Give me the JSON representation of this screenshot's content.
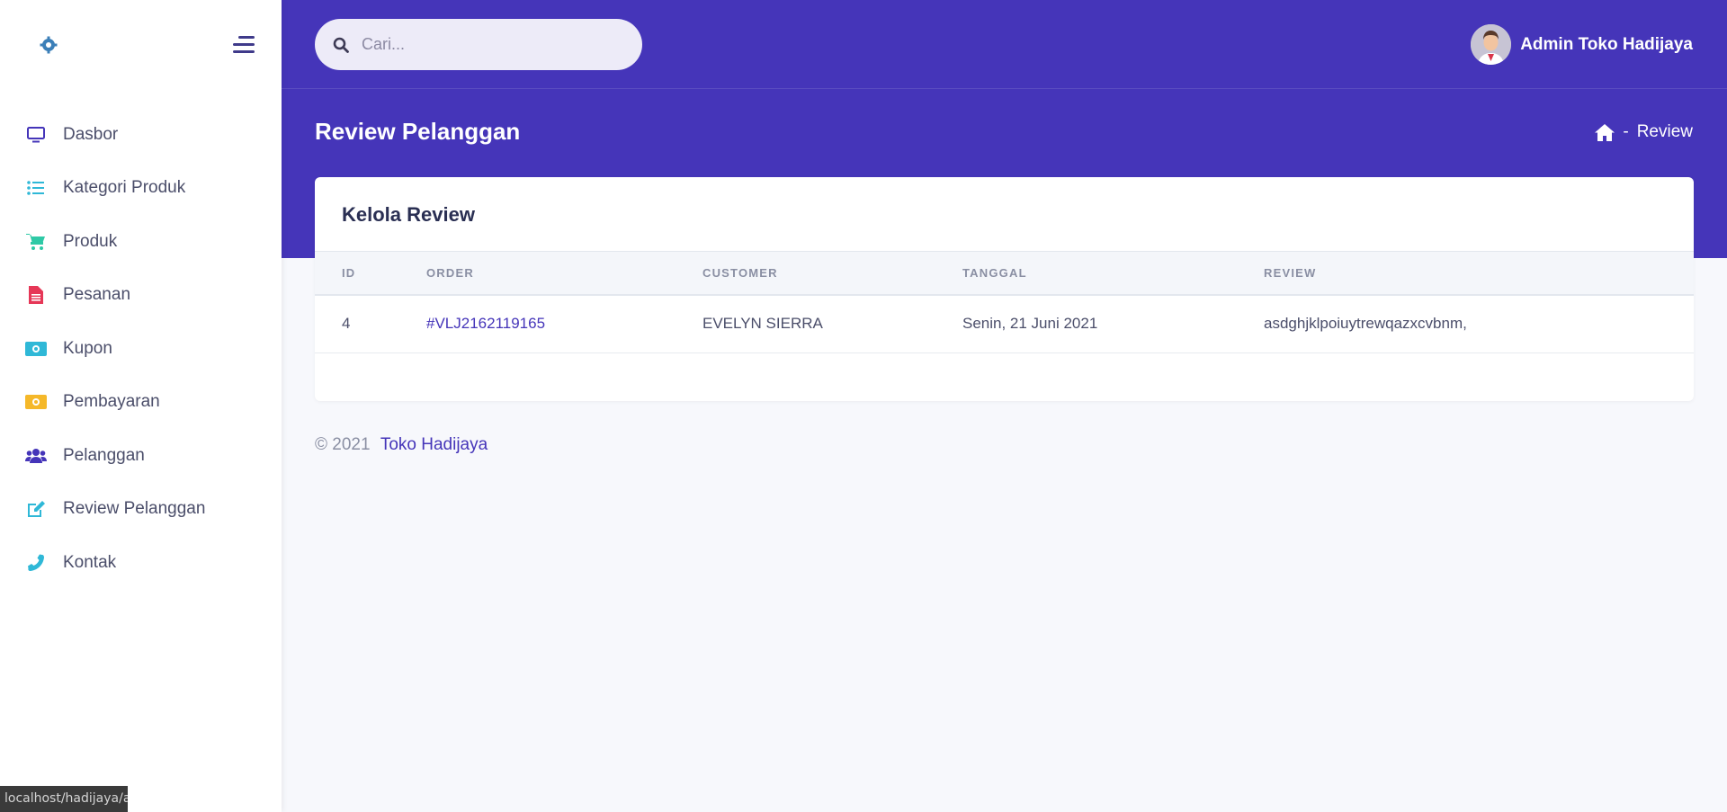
{
  "sidebar": {
    "items": [
      {
        "label": "Dasbor",
        "icon": "monitor-icon",
        "color": "#4535b9"
      },
      {
        "label": "Kategori Produk",
        "icon": "list-icon",
        "color": "#2fb8d7"
      },
      {
        "label": "Produk",
        "icon": "cart-icon",
        "color": "#2ec9a6"
      },
      {
        "label": "Pesanan",
        "icon": "document-icon",
        "color": "#e63757"
      },
      {
        "label": "Kupon",
        "icon": "money-icon",
        "color": "#2fb8d7"
      },
      {
        "label": "Pembayaran",
        "icon": "money-icon",
        "color": "#f5b829"
      },
      {
        "label": "Pelanggan",
        "icon": "users-icon",
        "color": "#4535b9"
      },
      {
        "label": "Review Pelanggan",
        "icon": "edit-icon",
        "color": "#2fb8d7"
      },
      {
        "label": "Kontak",
        "icon": "phone-icon",
        "color": "#2fb8d7"
      }
    ]
  },
  "header": {
    "search_placeholder": "Cari...",
    "user_name": "Admin Toko Hadijaya",
    "accent_color": "#4535b9"
  },
  "page": {
    "title": "Review Pelanggan",
    "breadcrumb_sep": "-",
    "breadcrumb_current": "Review"
  },
  "card": {
    "title": "Kelola Review",
    "columns": [
      "ID",
      "ORDER",
      "CUSTOMER",
      "TANGGAL",
      "REVIEW"
    ],
    "rows": [
      {
        "id": "4",
        "order": "#VLJ2162119165",
        "customer": "EVELYN SIERRA",
        "tanggal": "Senin, 21 Juni 2021",
        "review": "asdghjklpoiuytrewqazxcvbnm,"
      }
    ]
  },
  "footer": {
    "copyright": "© 2021",
    "brand": "Toko Hadijaya"
  },
  "status_bar": {
    "url": "localhost/hadijaya/a"
  }
}
